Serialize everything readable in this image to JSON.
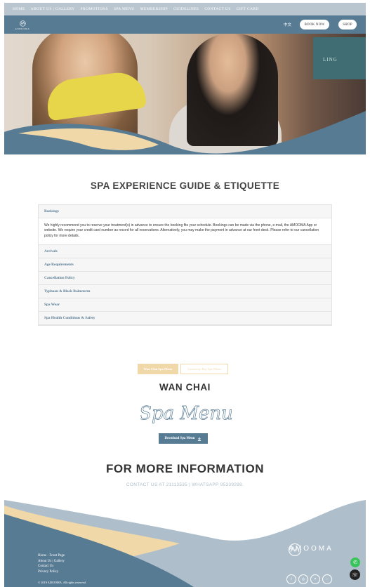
{
  "top_nav": {
    "items": [
      "HOME",
      "ABOUT US | GALLERY",
      "PROMOTIONS",
      "SPA MENU",
      "MEMBERSHIP",
      "GUIDELINES",
      "CONTACT US",
      "GIFT CARD"
    ]
  },
  "header": {
    "logo_text": "AMOOMA",
    "lang": "中文",
    "book_now": "BOOK NOW",
    "shop": "SHOP"
  },
  "hero": {
    "panel_text": "LING"
  },
  "guide": {
    "title": "SPA EXPERIENCE GUIDE & ETIQUETTE",
    "open_section": {
      "title": "Bookings",
      "body": "We highly recommend you to reserve your treatment(s) in advance to ensure the booking fits your schedule. Bookings can be made via the phone, e-mail, the AMOOMA App or website. We require your credit card number as record for all reservations. Alternatively, you may make the payment in advance at our front desk. Please refer to our cancellation policy for more details."
    },
    "sections": [
      "Arrivals",
      "Age Requirements",
      "Cancellation Policy",
      "Typhoon & Black Rainstorm",
      "Spa Wear",
      "Spa Health Conditions & Safety"
    ]
  },
  "spa_menu": {
    "tabs": [
      "Wan Chai Spa Menu",
      "Causeway Bay Spa Menu"
    ],
    "location": "WAN CHAI",
    "script_text": "Spa Menu",
    "download_label": "Download Spa Menu"
  },
  "info": {
    "title": "FOR MORE INFORMATION",
    "contact": "CONTACT US AT 21113535 | WHATSAPP 95339288."
  },
  "footer": {
    "links": [
      "Home - Front Page",
      "About Us | Gallery",
      "Contact Us",
      "Privacy Policy"
    ],
    "copyright": "© 2019 AMOOMA. All rights reserved.",
    "logo_text": "AMOOMA",
    "socials": [
      "facebook-icon",
      "instagram-icon",
      "twitter-icon",
      "wechat-icon"
    ]
  },
  "colors": {
    "brand_blue": "#587b94",
    "light_blue": "#aebfcb",
    "sand": "#f1d8a9"
  }
}
